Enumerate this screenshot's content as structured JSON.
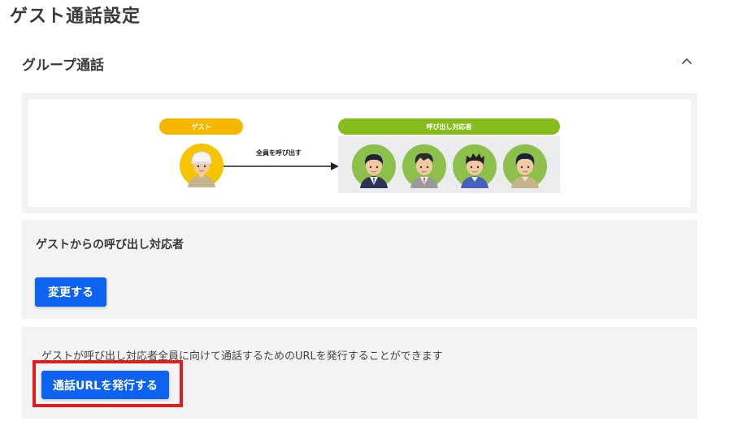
{
  "page": {
    "title": "ゲスト通話設定"
  },
  "section": {
    "title": "グループ通話",
    "toggle_icon": "chevron-up-icon"
  },
  "diagram": {
    "guest_label": "ゲスト",
    "responders_label": "呼び出し対応者",
    "arrow_label": "全員を呼び出す",
    "colors": {
      "guest": "#f5b700",
      "responders": "#84bd1c"
    }
  },
  "callee": {
    "title": "ゲストからの呼び出し対応者",
    "change_button": "変更する"
  },
  "url": {
    "description": "ゲストが呼び出し対応者全員に向けて通話するためのURLを発行することができます",
    "issue_button": "通話URLを発行する"
  },
  "accent_color": "#0d62f0",
  "highlight_color": "#e11c1c"
}
